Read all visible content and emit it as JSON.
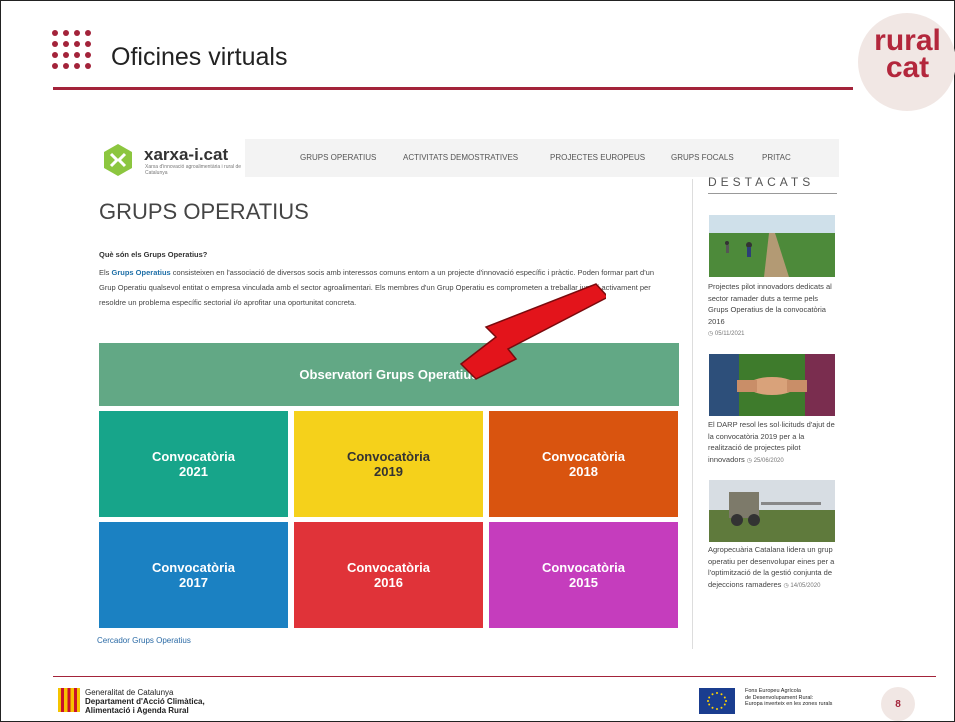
{
  "slide": {
    "title": "Oficines virtuals",
    "logo_text": [
      "rural",
      "cat"
    ],
    "page_number": "8"
  },
  "site": {
    "name": "xarxa-i.cat",
    "subtitle": "Xarxa d'innovació agroalimentària i rural de Catalunya",
    "menu": [
      "GRUPS OPERATIUS",
      "ACTIVITATS DEMOSTRATIVES",
      "PROJECTES EUROPEUS",
      "GRUPS FOCALS",
      "PRITAC"
    ]
  },
  "page": {
    "heading": "GRUPS OPERATIUS",
    "question": "Què són els Grups Operatius?",
    "intro_em": "Grups Operatius",
    "intro_pre": "Els ",
    "intro_post": " consisteixen en l'associació de diversos socis amb interessos comuns entorn a un projecte d'innovació específic i pràctic. Poden formar part d'un Grup Operatiu qualsevol entitat o empresa vinculada amb el sector agroalimentari. Els membres d'un Grup Operatiu es comprometen a treballar junts i activament per resoldre un problema específic sectorial i/o aprofitar una oportunitat concreta.",
    "observatori_button": "Observatori Grups Operatius",
    "tiles": [
      {
        "label": "Convocatòria",
        "year": "2021",
        "color": "#17a58a"
      },
      {
        "label": "Convocatòria",
        "year": "2019",
        "color": "#f5d11b"
      },
      {
        "label": "Convocatòria",
        "year": "2018",
        "color": "#d9540f"
      },
      {
        "label": "Convocatòria",
        "year": "2017",
        "color": "#1b81c2"
      },
      {
        "label": "Convocatòria",
        "year": "2016",
        "color": "#e03339"
      },
      {
        "label": "Convocatòria",
        "year": "2015",
        "color": "#c53dbd"
      }
    ],
    "cercador_link": "Cercador Grups Operatius"
  },
  "sidebar": {
    "heading": "DESTACATS",
    "news": [
      {
        "text": "Projectes pilot innovadors dedicats al sector ramader duts a terme pels Grups Operatius de la convocatòria 2016",
        "date": "05/11/2021"
      },
      {
        "text": "El DARP resol les sol·licituds d'ajut de la convocatòria 2019 per a la realització de projectes pilot innovadors",
        "date": "25/06/2020"
      },
      {
        "text": "Agropecuària Catalana lidera un grup operatiu per desenvolupar eines per a l'optimització de la gestió conjunta de dejeccions ramaderes",
        "date": "14/05/2020"
      }
    ]
  },
  "footer": {
    "gen_line1": "Generalitat de Catalunya",
    "gen_line2": "Departament d'Acció Climàtica,",
    "gen_line3": "Alimentació i Agenda Rural",
    "fund_line1": "Fons Europeu Agrícola",
    "fund_line2": "de Desenvolupament Rural:",
    "fund_line3": "Europa inverteix en les zones rurals"
  },
  "colors": {
    "accent": "#a3233a",
    "observatori": "#62a885",
    "arrow": "#e3141b"
  }
}
